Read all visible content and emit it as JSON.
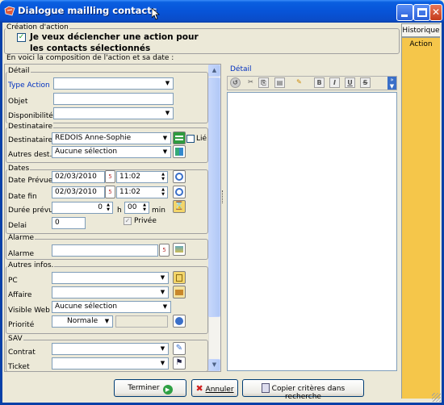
{
  "window": {
    "title": "Dialogue mailling contacts"
  },
  "tabs": [
    {
      "label": "Historique"
    },
    {
      "label": "Action"
    }
  ],
  "creation": {
    "group_label": "Création d'action",
    "checkbox_label": "Je veux déclencher une action pour les contacts sélectionnés",
    "checkbox_label_line1": "Je veux déclencher une action pour",
    "checkbox_label_line2": "les contacts sélectionnés",
    "checked": true,
    "intro": "En voici la composition de l'action et sa date :"
  },
  "detail": {
    "group_label": "Détail",
    "type_action_label": "Type Action",
    "type_action_value": "",
    "objet_label": "Objet",
    "objet_value": "",
    "disponibilite_label": "Disponibilité",
    "disponibilite_value": ""
  },
  "destinataire": {
    "group_label": "Destinataire",
    "destinataire_label": "Destinataire",
    "destinataire_value": "REDOIS Anne-Sophie",
    "lie_label": "Lié",
    "autres_label": "Autres dest.",
    "autres_value": "Aucune sélection"
  },
  "dates": {
    "group_label": "Dates",
    "date_prevue_label": "Date Prévue",
    "date_prevue_value": "02/03/2010",
    "time_prevue_value": "11:02",
    "date_fin_label": "Date fin",
    "date_fin_value": "02/03/2010",
    "time_fin_value": "11:02",
    "duree_label": "Durée prévue",
    "duree_hours": "0",
    "h_label": "h",
    "duree_minutes": "00",
    "min_label": "min",
    "privee_label": "Privée",
    "privee_checked": true,
    "delai_label": "Delai",
    "delai_value": "0"
  },
  "alarme": {
    "group_label": "Alarme",
    "alarme_label": "Alarme",
    "alarme_value": ""
  },
  "autres_infos": {
    "group_label": "Autres infos.",
    "pc_label": "PC",
    "pc_value": "",
    "affaire_label": "Affaire",
    "affaire_value": "",
    "visible_web_label": "Visible Web",
    "visible_web_value": "Aucune sélection",
    "priorite_label": "Priorité",
    "priorite_value": "Normale"
  },
  "sav": {
    "group_label": "SAV",
    "contrat_label": "Contrat",
    "contrat_value": "",
    "ticket_label": "Ticket",
    "ticket_value": ""
  },
  "editor": {
    "label": "Détail",
    "text": ""
  },
  "buttons": {
    "terminer": "Terminer",
    "annuler": "Annuler",
    "copier": "Copier critères dans recherche"
  },
  "colors": {
    "title_bar": "#0754D8",
    "label_blue": "#0030C0",
    "tab_active": "#F5C64A",
    "tab_panel": "#F3C24D"
  }
}
